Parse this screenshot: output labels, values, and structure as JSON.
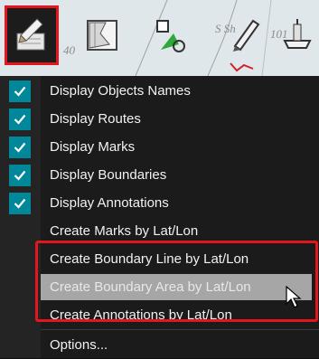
{
  "chart": {
    "labels": [
      "S Sh",
      "40",
      "101"
    ]
  },
  "toolbar": {
    "buttons": [
      {
        "name": "draw-tools-button",
        "icon": "pencil-notepad-icon",
        "selected": true
      },
      {
        "name": "area-tools-button",
        "icon": "map-area-icon",
        "selected": false
      },
      {
        "name": "route-tools-button",
        "icon": "route-point-icon",
        "selected": false
      },
      {
        "name": "annotation-tools-button",
        "icon": "pen-annotation-icon",
        "selected": false
      },
      {
        "name": "ship-tools-button",
        "icon": "ship-icon",
        "selected": false
      }
    ]
  },
  "menu": {
    "items": [
      {
        "label": "Display Objects Names",
        "checked": true
      },
      {
        "label": "Display Routes",
        "checked": true
      },
      {
        "label": "Display Marks",
        "checked": true
      },
      {
        "label": "Display Boundaries",
        "checked": true
      },
      {
        "label": "Display Annotations",
        "checked": true
      },
      {
        "label": "Create Marks by Lat/Lon",
        "checked": false
      },
      {
        "label": "Create Boundary Line by Lat/Lon",
        "checked": false
      },
      {
        "label": "Create Boundary Area by Lat/Lon",
        "checked": false,
        "hovered": true
      },
      {
        "label": "Create Annotations by Lat/Lon",
        "checked": false
      },
      {
        "label": "Options...",
        "checked": false
      }
    ]
  },
  "colors": {
    "accent": "#00889a",
    "highlight": "#e2161c",
    "hover": "#a6a6a6"
  }
}
